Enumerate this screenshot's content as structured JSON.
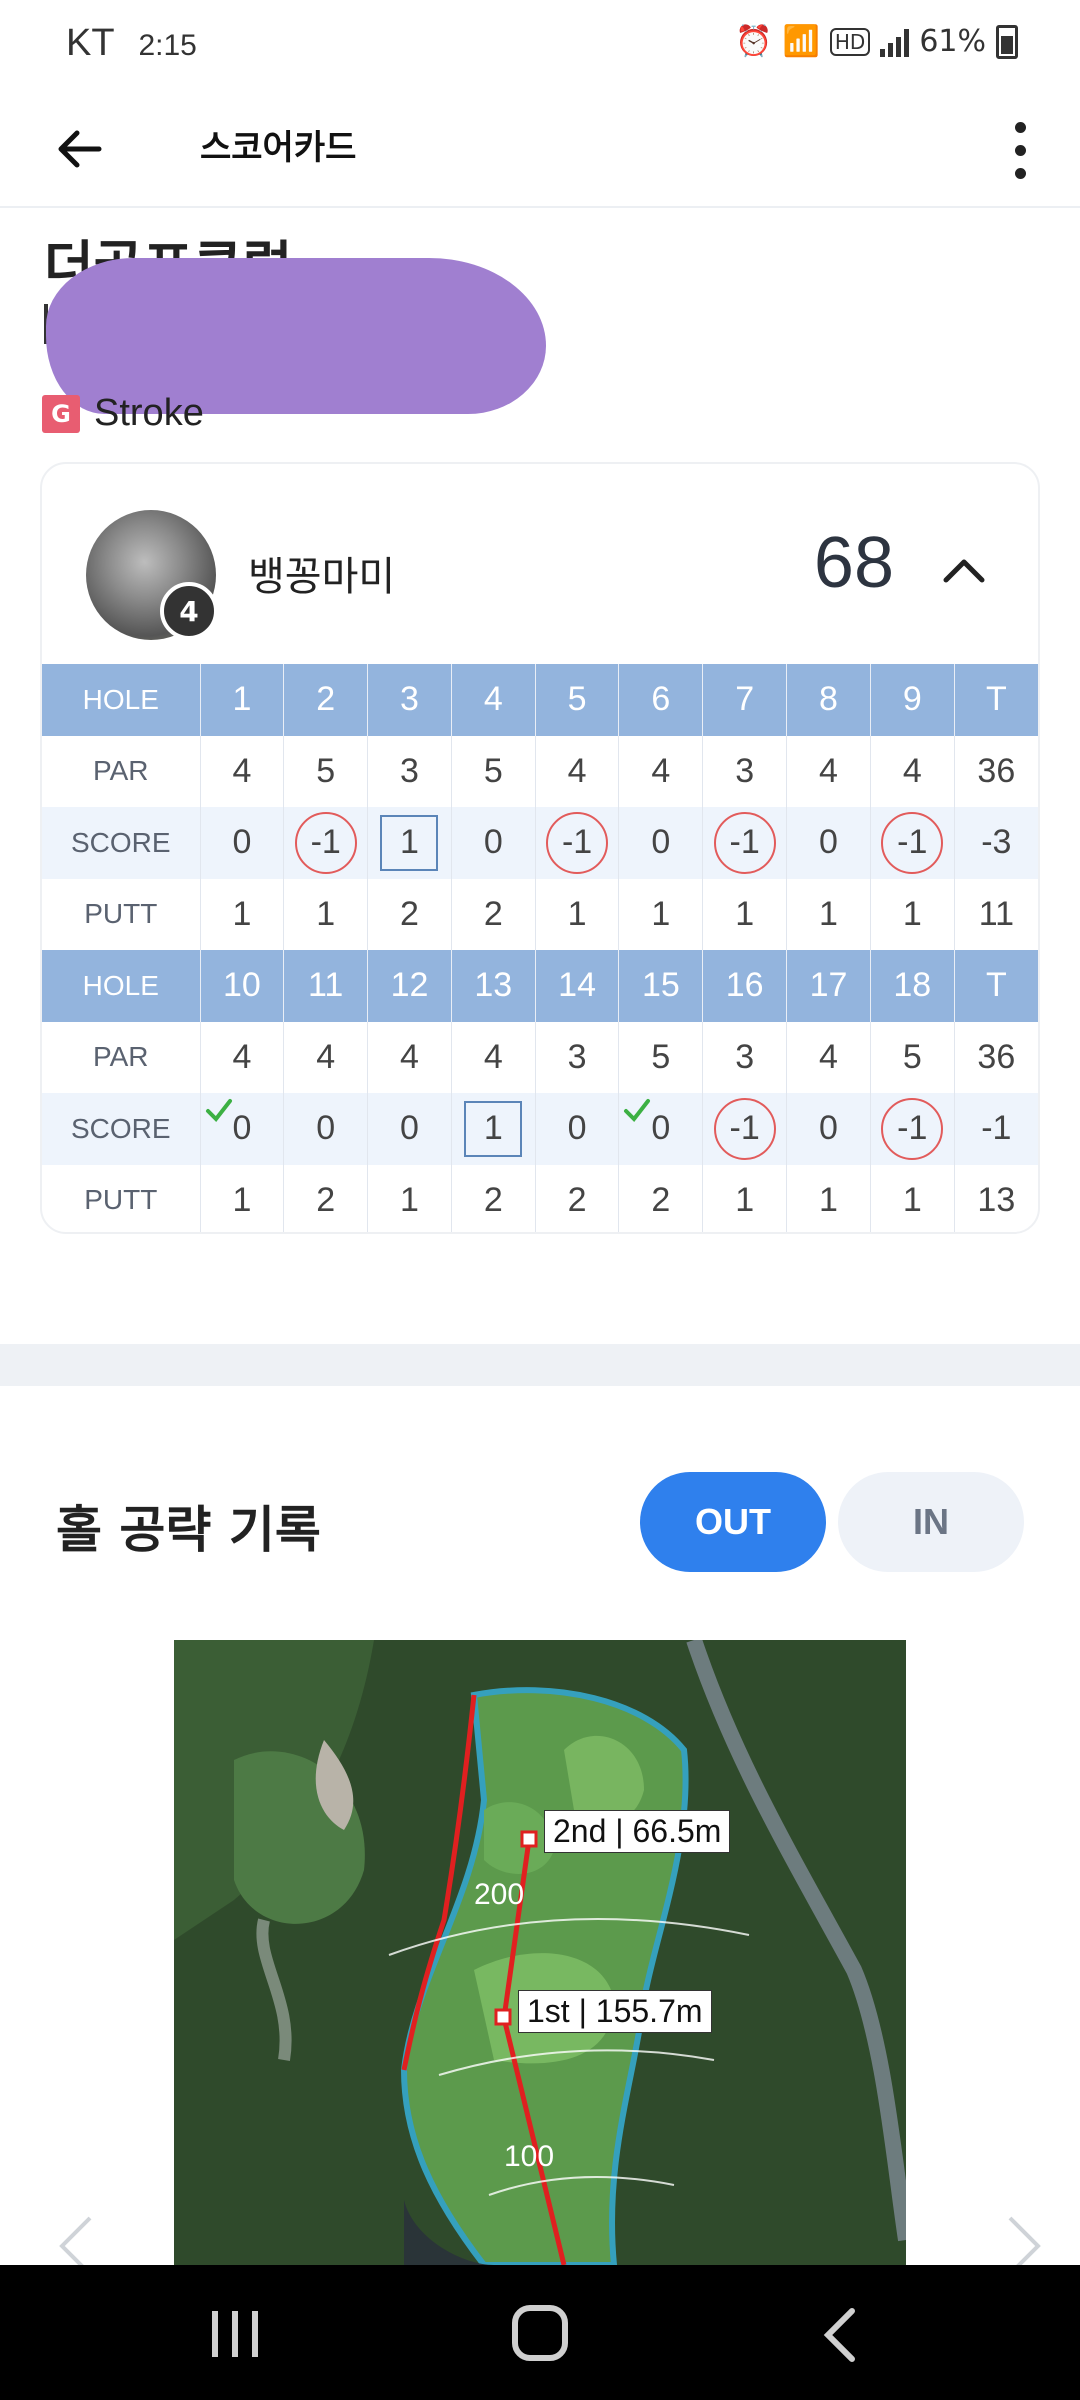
{
  "status": {
    "carrier": "KT",
    "time": "2:15",
    "network": "HD",
    "battery": "61%"
  },
  "appbar": {
    "title": "스코어카드"
  },
  "course": {
    "name": "더골프클럽",
    "game_type_badge": "G",
    "game_type": "Stroke"
  },
  "player": {
    "name": "뱅꽁마미",
    "handicap_badge": "4",
    "total": "68"
  },
  "scorecard": {
    "labels": {
      "hole": "HOLE",
      "par": "PAR",
      "score": "SCORE",
      "putt": "PUTT",
      "total": "T"
    },
    "front": {
      "holes": [
        "1",
        "2",
        "3",
        "4",
        "5",
        "6",
        "7",
        "8",
        "9"
      ],
      "par": [
        "4",
        "5",
        "3",
        "5",
        "4",
        "4",
        "3",
        "4",
        "4"
      ],
      "par_total": "36",
      "score": [
        "0",
        "-1",
        "1",
        "0",
        "-1",
        "0",
        "-1",
        "0",
        "-1"
      ],
      "score_total": "-3",
      "putt": [
        "1",
        "1",
        "2",
        "2",
        "1",
        "1",
        "1",
        "1",
        "1"
      ],
      "putt_total": "11"
    },
    "back": {
      "holes": [
        "10",
        "11",
        "12",
        "13",
        "14",
        "15",
        "16",
        "17",
        "18"
      ],
      "par": [
        "4",
        "4",
        "4",
        "4",
        "3",
        "5",
        "3",
        "4",
        "5"
      ],
      "par_total": "36",
      "score": [
        "0",
        "0",
        "0",
        "1",
        "0",
        "0",
        "-1",
        "0",
        "-1"
      ],
      "score_total": "-1",
      "putt": [
        "1",
        "2",
        "1",
        "2",
        "2",
        "2",
        "1",
        "1",
        "1"
      ],
      "putt_total": "13"
    }
  },
  "strategy": {
    "title": "홀 공략 기록",
    "out_label": "OUT",
    "in_label": "IN",
    "shots": [
      "2nd | 66.5m",
      "1st | 155.7m"
    ],
    "distance_markers": [
      "200",
      "100"
    ]
  }
}
